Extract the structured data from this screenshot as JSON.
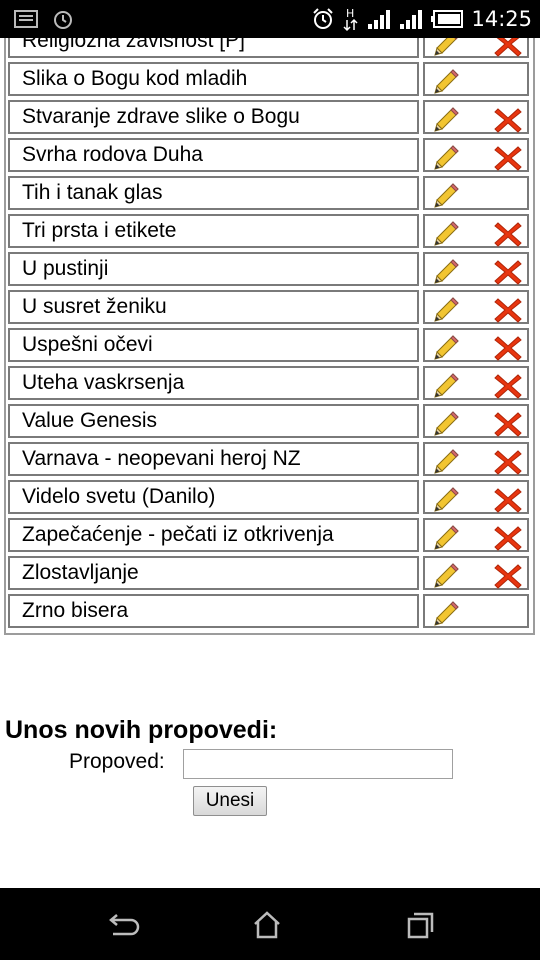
{
  "status_bar": {
    "time": "14:25",
    "icons": [
      "notification-icon",
      "alarm-icon",
      "hspa-data-icon",
      "signal-icon",
      "signal-icon",
      "battery-icon"
    ]
  },
  "sermons": {
    "rows": [
      {
        "title": "Religiozna zavisnost [P]",
        "deletable": true
      },
      {
        "title": "Slika o Bogu kod mladih",
        "deletable": false
      },
      {
        "title": "Stvaranje zdrave slike o Bogu",
        "deletable": true
      },
      {
        "title": "Svrha rodova Duha",
        "deletable": true
      },
      {
        "title": "Tih i tanak glas",
        "deletable": false
      },
      {
        "title": "Tri prsta i etikete",
        "deletable": true
      },
      {
        "title": "U pustinji",
        "deletable": true
      },
      {
        "title": "U susret ženiku",
        "deletable": true
      },
      {
        "title": "Uspešni očevi",
        "deletable": true
      },
      {
        "title": "Uteha vaskrsenja",
        "deletable": true
      },
      {
        "title": "Value Genesis",
        "deletable": true
      },
      {
        "title": "Varnava - neopevani heroj NZ",
        "deletable": true
      },
      {
        "title": "Videlo svetu (Danilo)",
        "deletable": true
      },
      {
        "title": "Zapečaćenje - pečati iz otkrivenja",
        "deletable": true
      },
      {
        "title": "Zlostavljanje",
        "deletable": true
      },
      {
        "title": "Zrno bisera",
        "deletable": false
      }
    ],
    "edit_icon": "pencil-icon",
    "delete_icon": "red-x-icon"
  },
  "new_entry": {
    "heading": "Unos novih propovedi:",
    "field_label": "Propoved:",
    "field_value": "",
    "submit_label": "Unesi"
  },
  "nav_bar": {
    "buttons": [
      "back-icon",
      "home-icon",
      "recent-apps-icon"
    ]
  },
  "colors": {
    "delete_red": "#e8350f",
    "pencil_yellow": "#f2c531",
    "cell_border": "#7a7a7a"
  }
}
